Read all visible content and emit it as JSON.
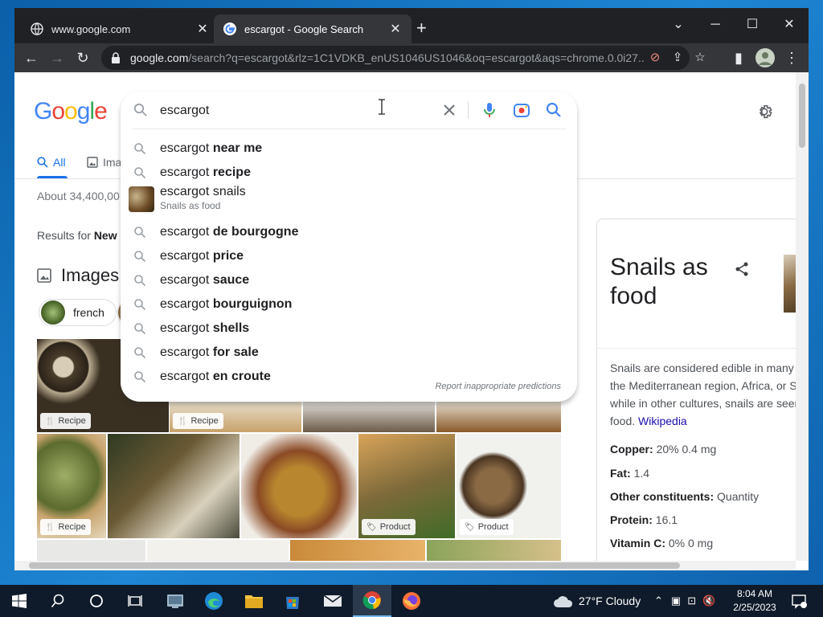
{
  "browser": {
    "tabs": [
      {
        "title": "www.google.com",
        "close": "✕"
      },
      {
        "title": "escargot - Google Search",
        "close": "✕"
      }
    ],
    "new_tab": "+",
    "window_controls": {
      "chevron": "⌄",
      "minimize": "─",
      "maximize": "☐",
      "close": "✕"
    },
    "url_host": "google.com",
    "url_path": "/search?q=escargot&rlz=1C1VDKB_enUS1046US1046&oq=escargot&aqs=chrome.0.0i27..."
  },
  "google": {
    "logo_letters": [
      "G",
      "o",
      "o",
      "g",
      "l",
      "e"
    ],
    "logo_colors": [
      "#4285F4",
      "#EA4335",
      "#FBBC05",
      "#4285F4",
      "#34A853",
      "#EA4335"
    ],
    "search_value": "escargot",
    "nav_tabs": [
      {
        "label": "All"
      },
      {
        "label": "Ima"
      }
    ],
    "stats": "About 34,400,00",
    "results_for_prefix": "Results for ",
    "results_for_place": "New",
    "images_heading": "Images",
    "chips": [
      {
        "label": "french"
      }
    ],
    "suggestions": [
      {
        "base": "escargot",
        "bold": " near me"
      },
      {
        "base": "escargot",
        "bold": " recipe"
      },
      {
        "base": "escargot snails",
        "sub": "Snails as food"
      },
      {
        "base": "escargot",
        "bold": " de bourgogne"
      },
      {
        "base": "escargot",
        "bold": " price"
      },
      {
        "base": "escargot",
        "bold": " sauce"
      },
      {
        "base": "escargot",
        "bold": " bourguignon"
      },
      {
        "base": "escargot",
        "bold": " shells"
      },
      {
        "base": "escargot",
        "bold": " for sale"
      },
      {
        "base": "escargot",
        "bold": " en croute"
      }
    ],
    "report": "Report inappropriate predictions",
    "badges": {
      "recipe": "Recipe",
      "product": "Product"
    }
  },
  "knowledge_panel": {
    "title": "Snails as food",
    "description": "Snails are considered edible in many",
    "description_2": "the Mediterranean region, Africa, or S",
    "description_3": "while in other cultures, snails are seen",
    "description_4": "food.",
    "source": "Wikipedia",
    "facts": [
      {
        "label": "Copper:",
        "value": "20% 0.4 mg"
      },
      {
        "label": "Fat:",
        "value": "1.4"
      },
      {
        "label": "Other constituents:",
        "value": "Quantity"
      },
      {
        "label": "Protein:",
        "value": "16.1"
      },
      {
        "label": "Vitamin C:",
        "value": "0% 0 mg"
      }
    ]
  },
  "taskbar": {
    "weather_temp": "27°F",
    "weather_text": "Cloudy",
    "time": "8:04 AM",
    "date": "2/25/2023"
  }
}
